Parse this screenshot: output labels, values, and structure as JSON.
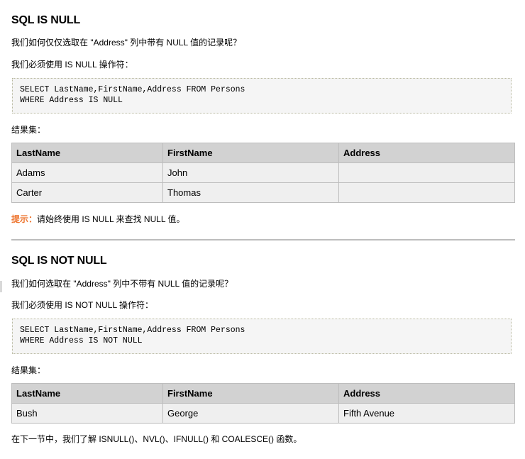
{
  "section1": {
    "title": "SQL IS NULL",
    "question": "我们如何仅仅选取在 \"Address\" 列中带有 NULL 值的记录呢？",
    "instruction": "我们必须使用 IS NULL 操作符：",
    "code": "SELECT LastName,FirstName,Address FROM Persons\nWHERE Address IS NULL",
    "result_label": "结果集：",
    "table": {
      "headers": [
        "LastName",
        "FirstName",
        "Address"
      ],
      "rows": [
        [
          "Adams",
          "John",
          ""
        ],
        [
          "Carter",
          "Thomas",
          ""
        ]
      ]
    },
    "tip_label": "提示：",
    "tip_text": "请始终使用 IS NULL 来查找 NULL 值。"
  },
  "section2": {
    "title": "SQL IS NOT NULL",
    "question": "我们如何选取在 \"Address\" 列中不带有 NULL 值的记录呢？",
    "instruction": "我们必须使用 IS NOT NULL 操作符：",
    "code": "SELECT LastName,FirstName,Address FROM Persons\nWHERE Address IS NOT NULL",
    "result_label": "结果集：",
    "table": {
      "headers": [
        "LastName",
        "FirstName",
        "Address"
      ],
      "rows": [
        [
          "Bush",
          "George",
          "Fifth Avenue"
        ]
      ]
    },
    "footer": "在下一节中，我们了解 ISNULL()、NVL()、IFNULL() 和 COALESCE() 函数。"
  },
  "colors": {
    "tip": "#ee7732",
    "table_header_bg": "#d2d2d2",
    "table_cell_bg": "#efefef",
    "code_bg": "#f5f5f5",
    "divider": "#bdbdbd"
  }
}
